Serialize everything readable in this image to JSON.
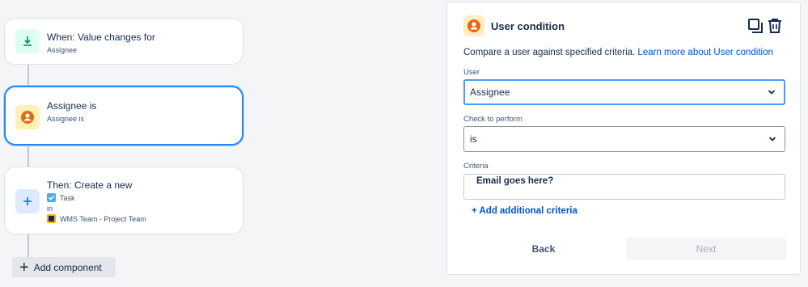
{
  "flow": {
    "trigger": {
      "title": "When: Value changes for",
      "subtitle": "Assignee"
    },
    "condition": {
      "title": "Assignee is",
      "subtitle": "Assignee is"
    },
    "action": {
      "title": "Then: Create a new",
      "issue_type": "Task",
      "in_label": "in",
      "project": "WMS Team - Project Team"
    },
    "add_component": "Add component"
  },
  "panel": {
    "title": "User condition",
    "description": "Compare a user against specified criteria.",
    "learn_more": "Learn more about User condition",
    "user_label": "User",
    "user_value": "Assignee",
    "check_label": "Check to perform",
    "check_value": "is",
    "criteria_label": "Criteria",
    "criteria_value": "Email goes here?",
    "add_criteria": "+ Add additional criteria",
    "back": "Back",
    "next": "Next"
  },
  "colors": {
    "accent": "#2684ff",
    "link": "#0052cc",
    "trigger_bg": "#dcfff1",
    "trigger_icon": "#00875a",
    "condition_bg": "#fff0b3",
    "condition_icon": "#e56910",
    "action_bg": "#deebff",
    "action_icon": "#0065ff"
  },
  "icons": [
    "download-arrow-icon",
    "user-icon",
    "plus-icon",
    "checkbox-icon",
    "project-icon",
    "copy-icon",
    "trash-icon",
    "chevron-down-icon"
  ]
}
